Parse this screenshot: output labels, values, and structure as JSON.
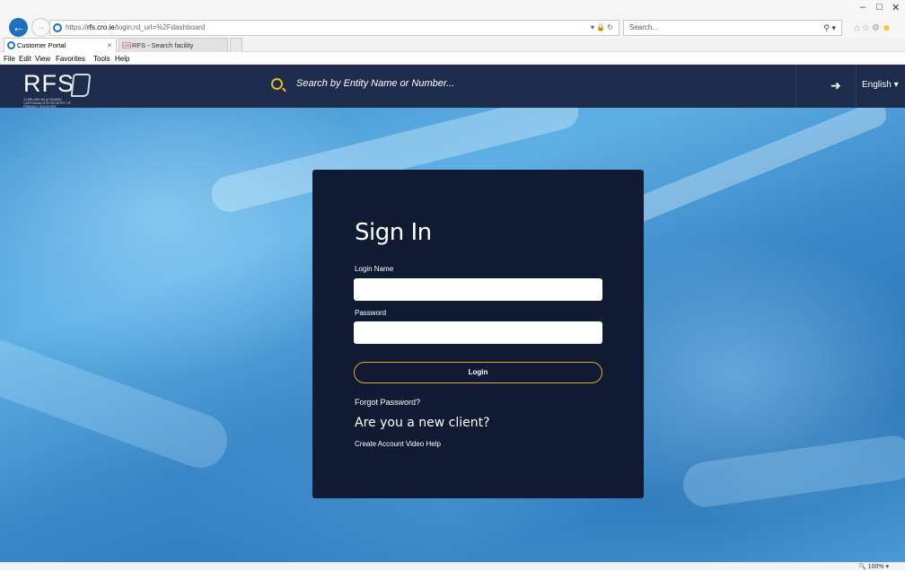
{
  "browser": {
    "url_prefix": "https://",
    "url_domain": "rfs.cro.ie",
    "url_path": "/login;rd_url=%2Fdashboard",
    "search_placeholder": "Search...",
    "tabs": [
      {
        "label": "Customer Portal"
      },
      {
        "label": "RFS - Search facility"
      }
    ],
    "menu": [
      "File",
      "Edit",
      "View",
      "Favorites",
      "Tools",
      "Help"
    ],
    "zoom": "100%"
  },
  "site": {
    "logo_text": "RFS",
    "logo_subtext": "CLÁRLANN NA gCUMANN CARTHANACHTA REGISTRY OF FRIENDLY SOCIETIES",
    "search_placeholder": "Search by Entity Name or Number...",
    "language": "English"
  },
  "login": {
    "title": "Sign In",
    "login_name_label": "Login Name",
    "password_label": "Password",
    "login_button": "Login",
    "forgot_password": "Forgot Password?",
    "new_client_heading": "Are you a new client?",
    "create_account_video_help": "Create Account Video Help"
  },
  "colors": {
    "header_bg": "#1d2c4d",
    "card_bg": "#101a33",
    "accent": "#e0a92a",
    "browser_blue": "#1b72c4"
  }
}
